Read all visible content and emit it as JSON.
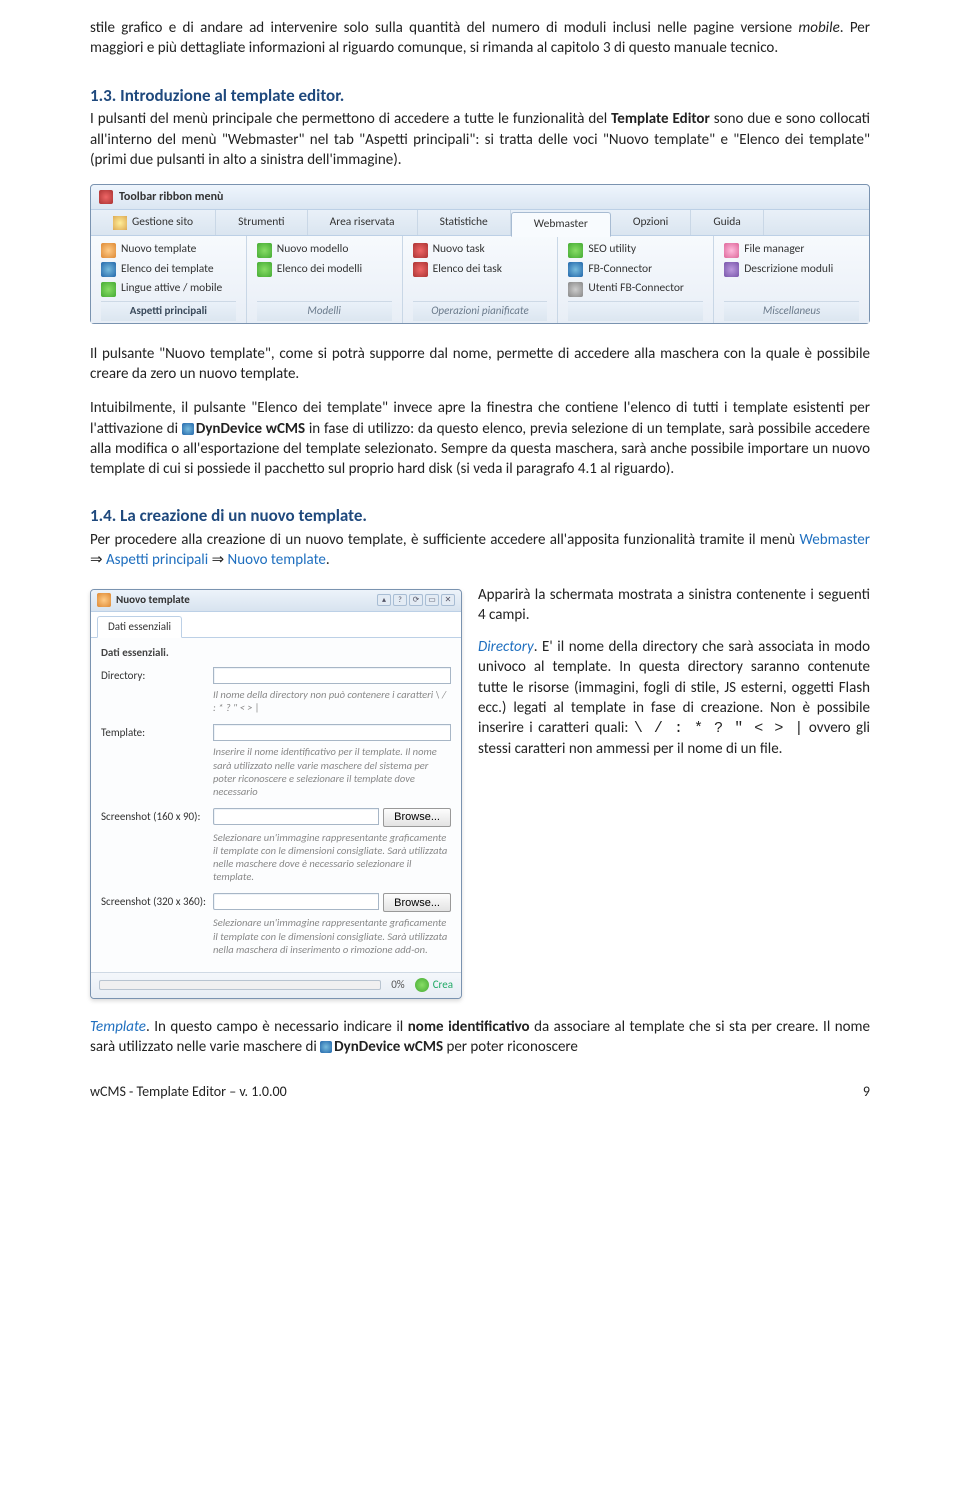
{
  "paragraphs": {
    "p1a": "stile grafico e di andare ad intervenire solo sulla quantità del numero di moduli inclusi nelle pagine versione ",
    "p1b": "mobile",
    "p1c": ". Per maggiori e più dettagliate informazioni al riguardo comunque, si rimanda al capitolo 3 di questo manuale tecnico.",
    "h1": "1.3. Introduzione al template editor.",
    "p2a": "I pulsanti del menù principale che permettono di accedere a tutte le funzionalità del ",
    "p2b": "Template Editor",
    "p2c": " sono due e sono collocati all'interno del menù \"Webmaster\" nel tab \"Aspetti principali\": si tratta delle voci \"Nuovo template\" e \"Elenco dei template\" (primi due pulsanti in alto a sinistra dell'immagine).",
    "p3": "Il pulsante \"Nuovo template\", come si potrà supporre dal nome, permette di accedere alla maschera con la quale è possibile creare da zero un nuovo template.",
    "p4a": "Intuibilmente, il pulsante \"Elenco dei template\" invece apre la finestra che contiene l'elenco di tutti i template esistenti per l'attivazione di ",
    "p4b": "DynDevice wCMS",
    "p4c": " in fase di utilizzo: da questo elenco, previa selezione di un template, sarà possibile accedere alla modifica o all'esportazione del template selezionato. Sempre da questa maschera, sarà anche possibile importare un nuovo template di cui si possiede il pacchetto sul proprio hard disk (si veda il paragrafo 4.1 al riguardo).",
    "h2": "1.4. La creazione di un nuovo template.",
    "p5a": "Per procedere alla creazione di un nuovo template, è sufficiente accedere all'apposita funzionalità tramite il menù ",
    "p5b": "Webmaster",
    "p5c": " ⇒ ",
    "p5d": "Aspetti principali",
    "p5e": " ⇒ ",
    "p5f": "Nuovo template",
    "p5g": ".",
    "p6": "Apparirà la schermata mostrata a sinistra contenente i seguenti 4 campi.",
    "p7a": "Directory",
    "p7b": ". E' il nome della directory che sarà associata in modo univoco al template. In questa directory saranno contenute tutte le risorse (immagini, fogli di stile, JS esterni, oggetti Flash ecc.) legati al template in fase di creazione. Non è possibile inserire i caratteri quali: ",
    "p7chars": "\\   /   :   *   ?   \"   <   >   |",
    "p7c": " ovvero gli stessi caratteri non ammessi per il nome di un file.",
    "p8a": "Template",
    "p8b": ". In questo campo è necessario indicare il ",
    "p8c": "nome identificativo",
    "p8d": " da associare al template che si sta per creare. Il nome sarà utilizzato nelle varie maschere di ",
    "p8e": "DynDevice wCMS",
    "p8f": " per poter riconoscere"
  },
  "ribbon": {
    "title": "Toolbar ribbon menù",
    "tabs": [
      "Gestione sito",
      "Strumenti",
      "Area riservata",
      "Statistiche",
      "Webmaster",
      "Opzioni",
      "Guida"
    ],
    "groups": [
      {
        "label": "Aspetti principali",
        "labelBold": true,
        "items": [
          "Nuovo template",
          "Elenco dei template",
          "Lingue attive / mobile"
        ]
      },
      {
        "label": "Modelli",
        "items": [
          "Nuovo modello",
          "Elenco dei modelli",
          ""
        ]
      },
      {
        "label": "Operazioni pianificate",
        "items": [
          "Nuovo task",
          "Elenco dei task",
          ""
        ]
      },
      {
        "label": "",
        "items": [
          "SEO utility",
          "FB-Connector",
          "Utenti FB-Connector"
        ]
      },
      {
        "label": "Miscellaneus",
        "items": [
          "File manager",
          "Descrizione moduli",
          ""
        ]
      }
    ]
  },
  "form": {
    "title": "Nuovo template",
    "tab": "Dati essenziali",
    "section": "Dati essenziali.",
    "fields": {
      "dir_label": "Directory:",
      "dir_hint": "Il nome della directory non può contenere i caratteri \\ / : * ? \" < > |",
      "tpl_label": "Template:",
      "tpl_hint": "Inserire il nome identificativo per il template. Il nome sarà utilizzato nelle varie maschere del sistema per poter riconoscere e selezionare il template dove necessario",
      "ss1_label": "Screenshot (160 x 90):",
      "ss1_hint": "Selezionare un'immagine rappresentante graficamente il template con le dimensioni consigliate. Sarà utilizzata nelle maschere dove è necessario selezionare il template.",
      "ss2_label": "Screenshot (320 x 360):",
      "ss2_hint": "Selezionare un'immagine rappresentante graficamente il template con le dimensioni consigliate. Sarà utilizzata nella maschera di inserimento o rimozione add-on.",
      "browse": "Browse..."
    },
    "footer": {
      "pct": "0%",
      "crea": "Crea"
    }
  },
  "footer": {
    "left": "wCMS - Template Editor – v. 1.0.00",
    "right": "9"
  }
}
